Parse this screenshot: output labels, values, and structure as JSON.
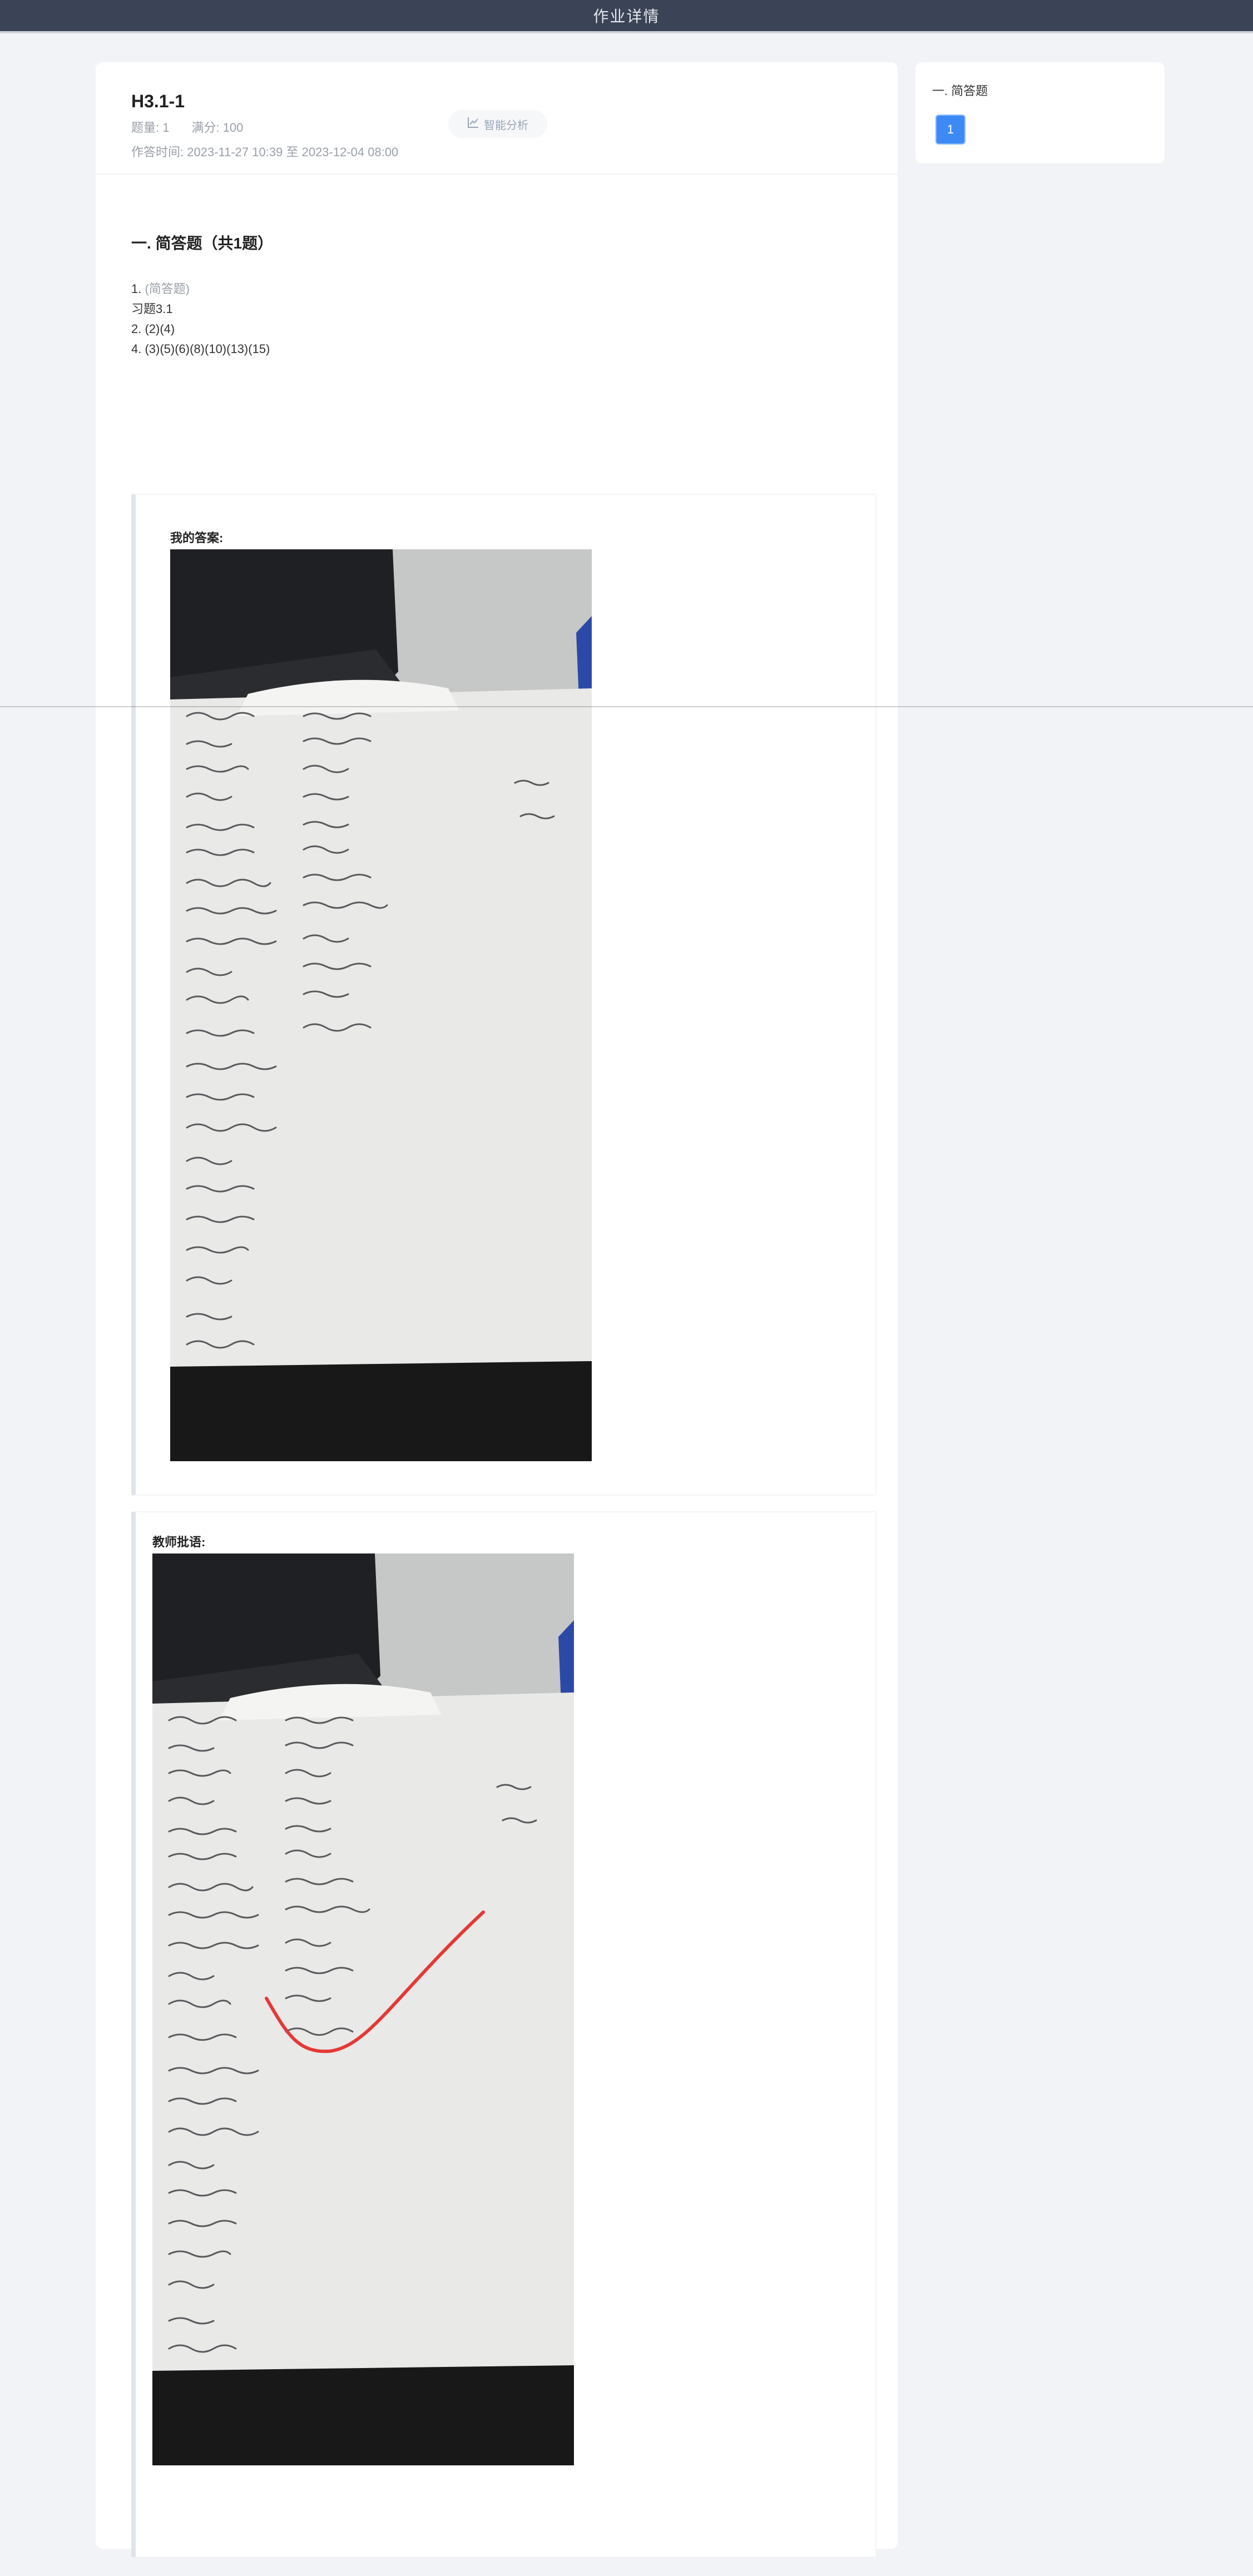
{
  "topbar": {
    "title": "作业详情"
  },
  "homework": {
    "title": "H3.1-1",
    "count_label": "题量: 1",
    "score_label": "满分: 100",
    "time_label": "作答时间:",
    "time_start": "2023-11-27 10:39",
    "time_sep": "至",
    "time_end": "2023-12-04 08:00",
    "analysis_button": "智能分析"
  },
  "section": {
    "title": "一. 简答题（共1题）"
  },
  "question": {
    "number": "1.",
    "type": "(简答题)",
    "lines": [
      "习题3.1",
      "2. (2)(4)",
      "4. (3)(5)(6)(8)(10)(13)(15)"
    ]
  },
  "my_answer": {
    "label": "我的答案:"
  },
  "teacher": {
    "label": "教师批语:"
  },
  "sidebar": {
    "section": "一. 简答题",
    "items": [
      "1"
    ]
  },
  "colors": {
    "topbar": "#3b4356",
    "accent": "#3d8af7",
    "check_mark": "#e53935"
  }
}
